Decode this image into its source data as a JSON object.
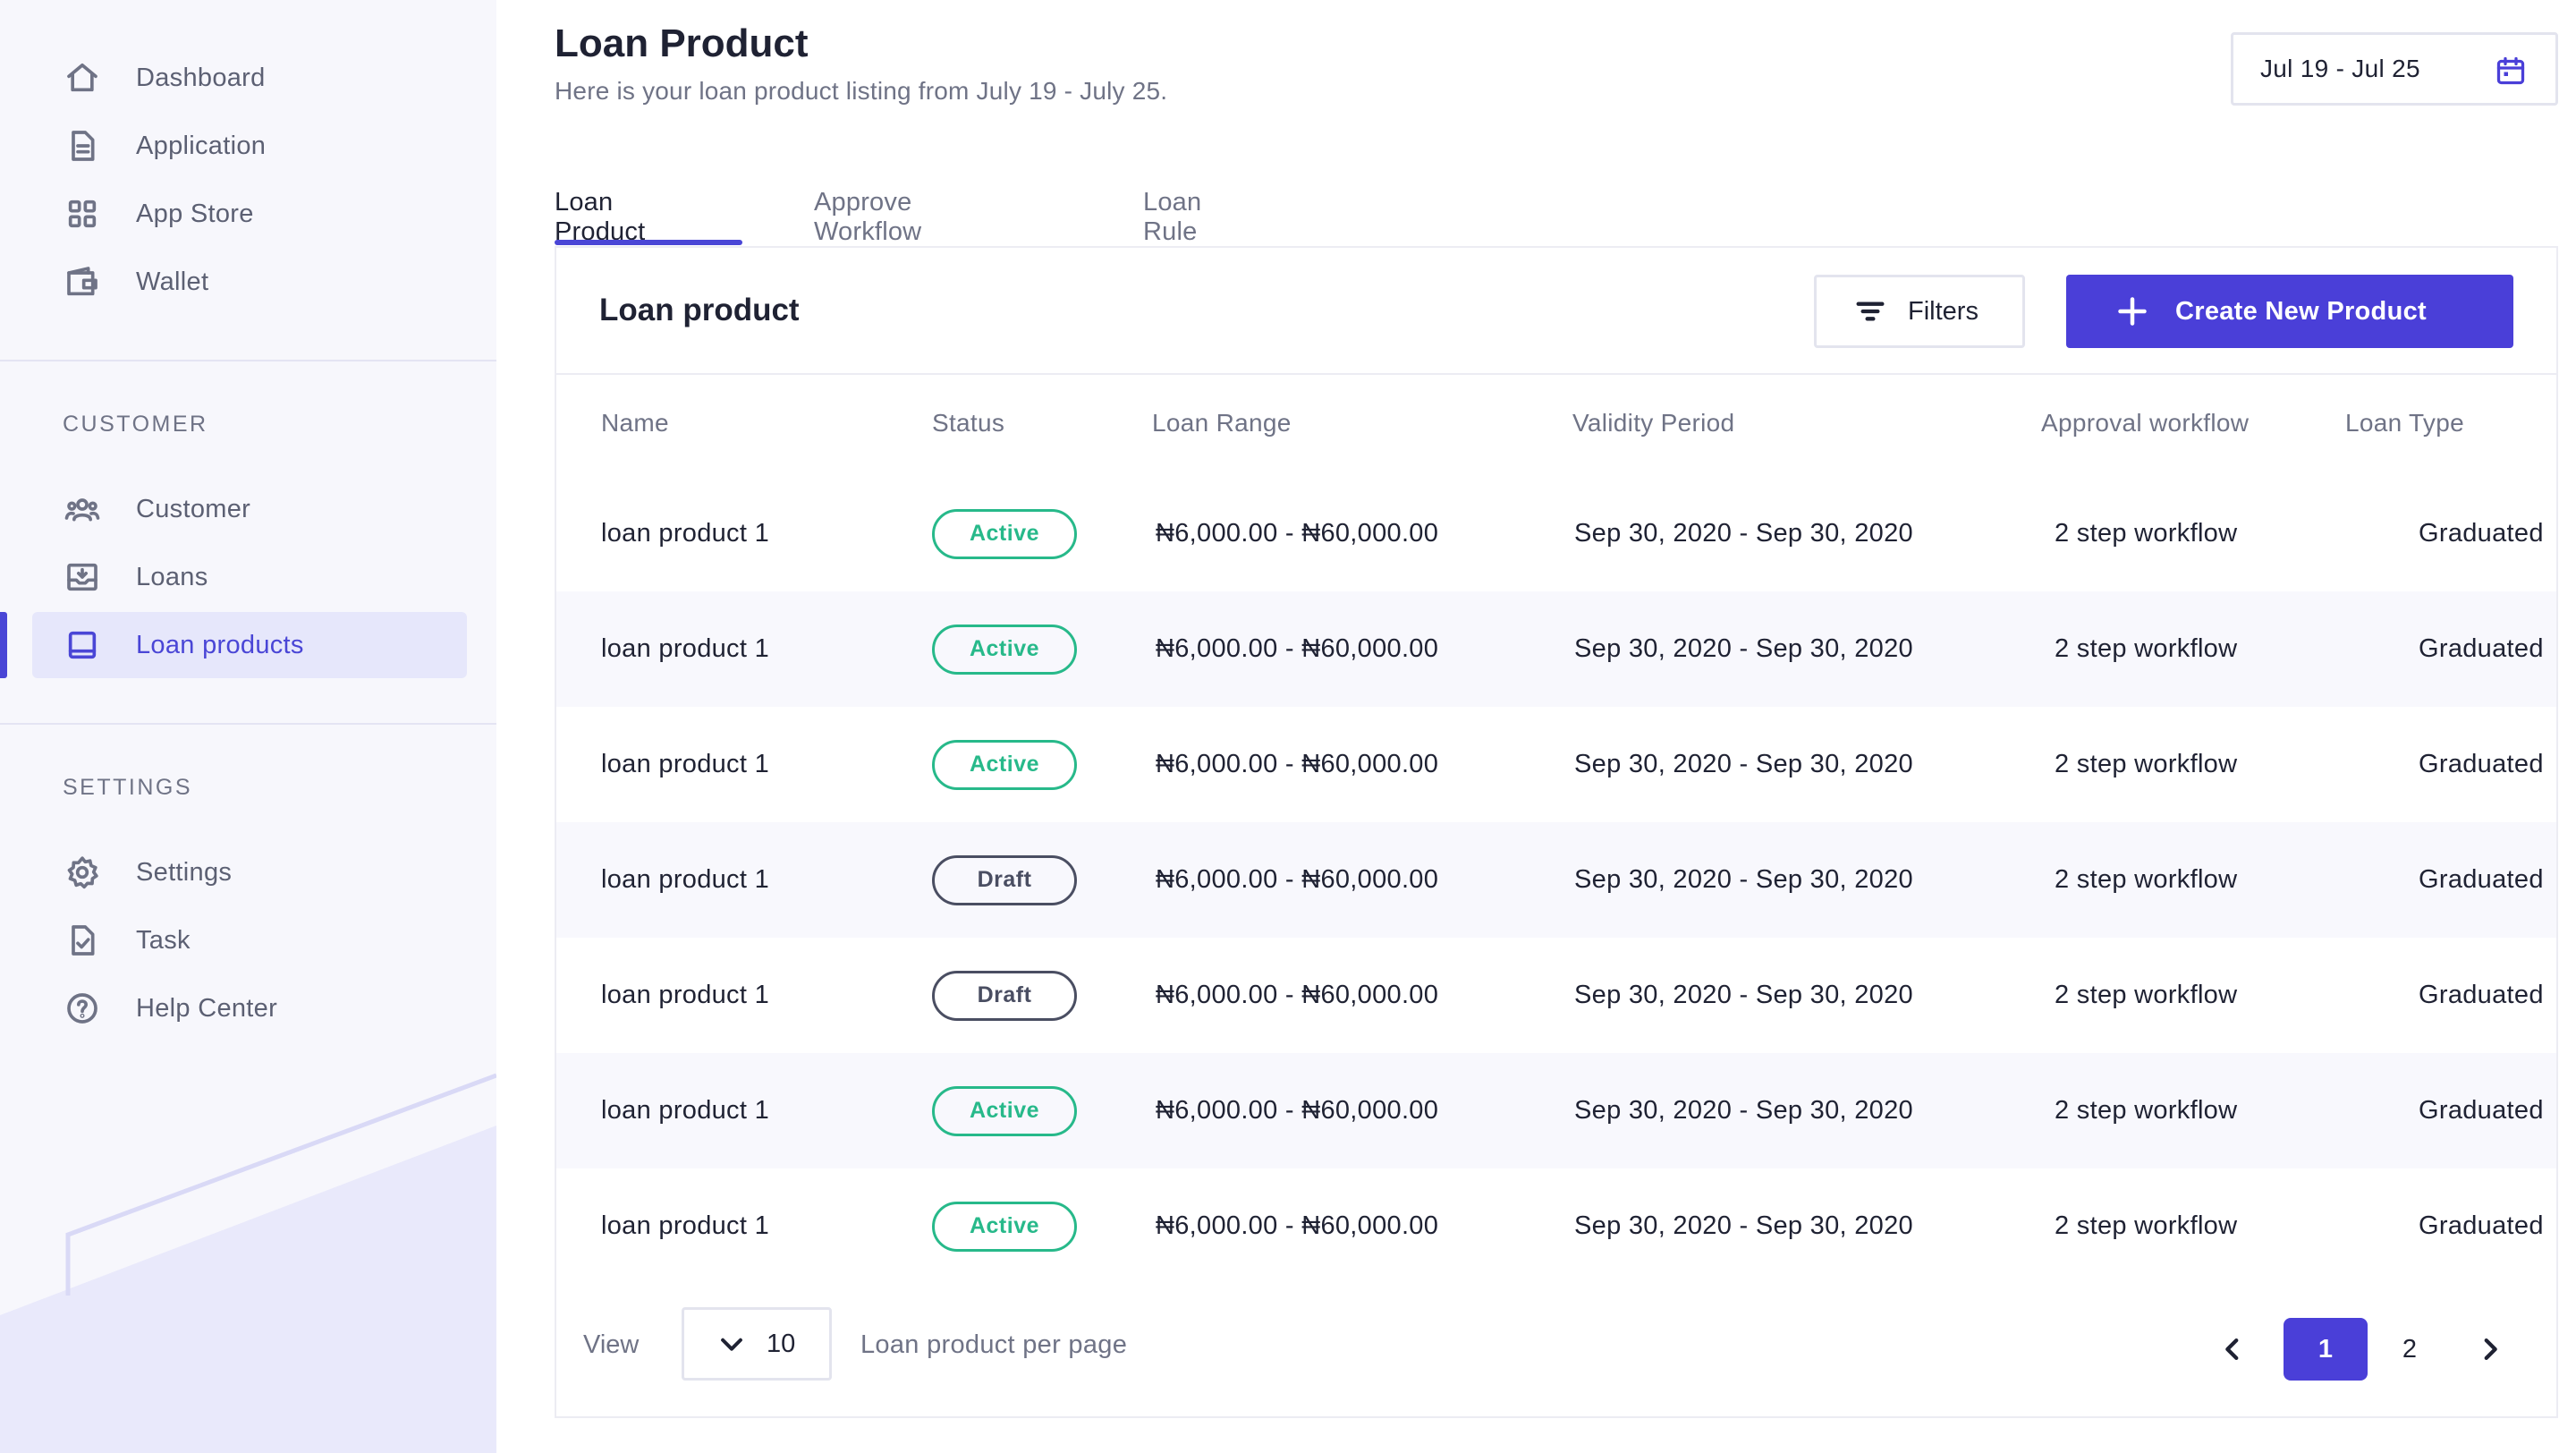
{
  "sidebar": {
    "main_items": [
      {
        "label": "Dashboard",
        "icon": "home-icon"
      },
      {
        "label": "Application",
        "icon": "document-icon"
      },
      {
        "label": "App Store",
        "icon": "grid-icon"
      },
      {
        "label": "Wallet",
        "icon": "wallet-icon"
      }
    ],
    "customer_section": "CUSTOMER",
    "customer_items": [
      {
        "label": "Customer",
        "icon": "users-icon"
      },
      {
        "label": "Loans",
        "icon": "inbox-icon"
      },
      {
        "label": "Loan products",
        "icon": "book-icon",
        "active": true
      }
    ],
    "settings_section": "SETTINGS",
    "settings_items": [
      {
        "label": "Settings",
        "icon": "gear-icon"
      },
      {
        "label": "Task",
        "icon": "task-icon"
      },
      {
        "label": "Help Center",
        "icon": "help-icon"
      }
    ]
  },
  "header": {
    "title": "Loan Product",
    "subtitle": "Here is your loan product listing from July 19 - July 25.",
    "date_range": "Jul 19 - Jul 25"
  },
  "tabs": [
    {
      "label": "Loan Product",
      "active": true
    },
    {
      "label": "Approve Workflow",
      "active": false
    },
    {
      "label": "Loan Rule",
      "active": false
    }
  ],
  "card": {
    "title": "Loan product",
    "filters_label": "Filters",
    "create_label": "Create New Product"
  },
  "table": {
    "columns": [
      "Name",
      "Status",
      "Loan Range",
      "Validity Period",
      "Approval workflow",
      "Loan Type"
    ],
    "rows": [
      {
        "name": "loan product 1",
        "status": "Active",
        "range": "₦6,000.00 - ₦60,000.00",
        "validity": "Sep 30, 2020 - Sep 30, 2020",
        "workflow": "2 step workflow",
        "type": "Graduated"
      },
      {
        "name": "loan product 1",
        "status": "Active",
        "range": "₦6,000.00 - ₦60,000.00",
        "validity": "Sep 30, 2020 - Sep 30, 2020",
        "workflow": "2 step workflow",
        "type": "Graduated"
      },
      {
        "name": "loan product 1",
        "status": "Active",
        "range": "₦6,000.00 - ₦60,000.00",
        "validity": "Sep 30, 2020 - Sep 30, 2020",
        "workflow": "2 step workflow",
        "type": "Graduated"
      },
      {
        "name": "loan product 1",
        "status": "Draft",
        "range": "₦6,000.00 - ₦60,000.00",
        "validity": "Sep 30, 2020 - Sep 30, 2020",
        "workflow": "2 step workflow",
        "type": "Graduated"
      },
      {
        "name": "loan product 1",
        "status": "Draft",
        "range": "₦6,000.00 - ₦60,000.00",
        "validity": "Sep 30, 2020 - Sep 30, 2020",
        "workflow": "2 step workflow",
        "type": "Graduated"
      },
      {
        "name": "loan product 1",
        "status": "Active",
        "range": "₦6,000.00 - ₦60,000.00",
        "validity": "Sep 30, 2020 - Sep 30, 2020",
        "workflow": "2 step workflow",
        "type": "Graduated"
      },
      {
        "name": "loan product 1",
        "status": "Active",
        "range": "₦6,000.00 - ₦60,000.00",
        "validity": "Sep 30, 2020 - Sep 30, 2020",
        "workflow": "2 step workflow",
        "type": "Graduated"
      }
    ]
  },
  "footer": {
    "view_label": "View",
    "per_page_value": "10",
    "per_page_label": "Loan product per page",
    "pages": [
      "1",
      "2"
    ],
    "current_page": "1"
  },
  "colors": {
    "accent": "#4a3fd8",
    "active_status": "#27b98a",
    "draft_status": "#4a4e62",
    "sidebar_bg": "#f7f7fc"
  }
}
